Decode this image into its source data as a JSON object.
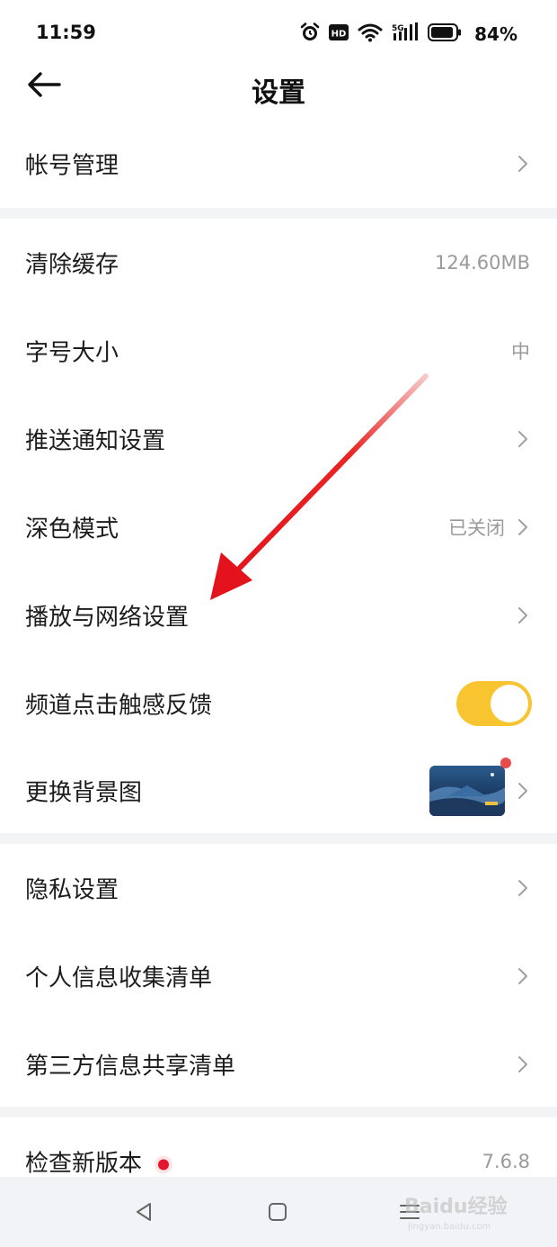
{
  "status_bar": {
    "time": "11:59",
    "battery": "84%",
    "icons": [
      "alarm-icon",
      "hd-icon",
      "wifi-icon",
      "5g-signal-icon",
      "battery-icon"
    ]
  },
  "header": {
    "title": "设置",
    "back_icon": "arrow-left-icon"
  },
  "settings": {
    "account": {
      "label": "帐号管理"
    },
    "clear_cache": {
      "label": "清除缓存",
      "value": "124.60MB"
    },
    "font_size": {
      "label": "字号大小",
      "value": "中"
    },
    "push": {
      "label": "推送通知设置"
    },
    "dark_mode": {
      "label": "深色模式",
      "value": "已关闭"
    },
    "playback": {
      "label": "播放与网络设置"
    },
    "haptic": {
      "label": "频道点击触感反馈",
      "enabled": true
    },
    "background": {
      "label": "更换背景图"
    },
    "privacy": {
      "label": "隐私设置"
    },
    "personal_info": {
      "label": "个人信息收集清单"
    },
    "third_party": {
      "label": "第三方信息共享清单"
    },
    "update": {
      "label": "检查新版本",
      "value": "7.6.8"
    }
  },
  "nav_bar": {
    "icons": [
      "back-triangle-icon",
      "home-square-icon",
      "menu-lines-icon"
    ]
  },
  "colors": {
    "toggle_on": "#f8c531",
    "annotation_arrow": "#e3121c",
    "badge_red": "#e3152d",
    "divider": "#f3f4f6"
  },
  "watermark": {
    "text": "Baidu经验",
    "subtext": "jingyan.baidu.com"
  }
}
